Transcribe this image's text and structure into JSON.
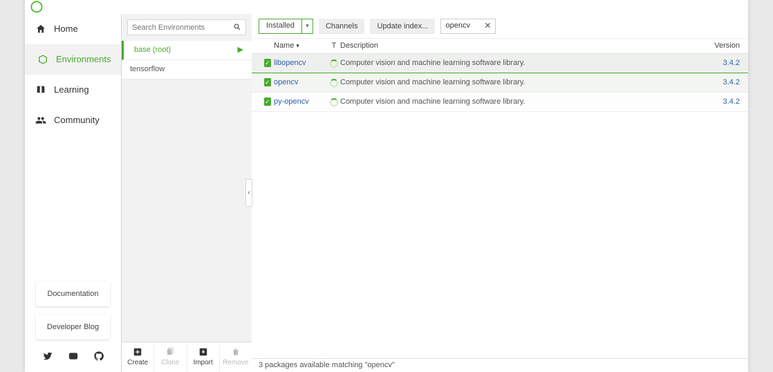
{
  "sidebar": {
    "items": [
      {
        "label": "Home"
      },
      {
        "label": "Environments"
      },
      {
        "label": "Learning"
      },
      {
        "label": "Community"
      }
    ],
    "cards": [
      {
        "label": "Documentation"
      },
      {
        "label": "Developer Blog"
      }
    ]
  },
  "env": {
    "search_placeholder": "Search Environments",
    "items": [
      {
        "name": "base (root)"
      },
      {
        "name": "tensorflow"
      }
    ],
    "actions": [
      {
        "label": "Create"
      },
      {
        "label": "Clone"
      },
      {
        "label": "Import"
      },
      {
        "label": "Remove"
      }
    ]
  },
  "toolbar": {
    "filter_value": "Installed",
    "channels_label": "Channels",
    "update_label": "Update index...",
    "search_value": "opencv"
  },
  "columns": {
    "name": "Name",
    "t": "T",
    "desc": "Description",
    "ver": "Version"
  },
  "packages": [
    {
      "name": "libopencv",
      "desc": "Computer vision and machine learning software library.",
      "version": "3.4.2"
    },
    {
      "name": "opencv",
      "desc": "Computer vision and machine learning software library.",
      "version": "3.4.2"
    },
    {
      "name": "py-opencv",
      "desc": "Computer vision and machine learning software library.",
      "version": "3.4.2"
    }
  ],
  "status": "3 packages available matching \"opencv\""
}
